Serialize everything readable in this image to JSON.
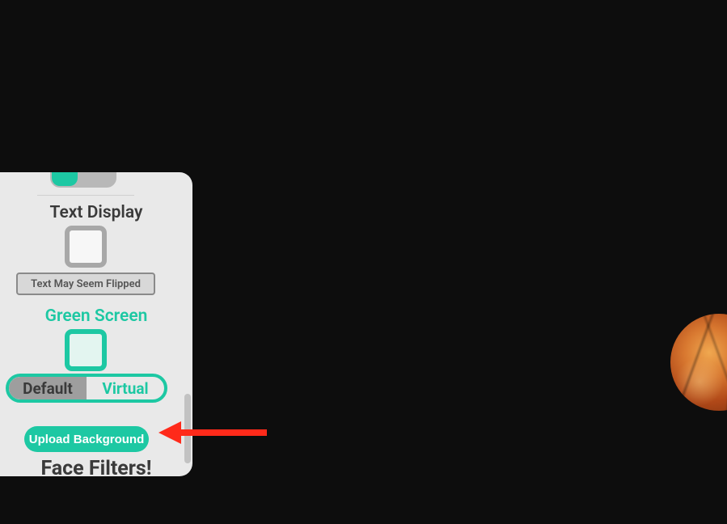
{
  "panel": {
    "text_display_title": "Text Display",
    "flip_note": "Text May Seem Flipped",
    "green_screen_title": "Green Screen",
    "mode": {
      "default_label": "Default",
      "virtual_label": "Virtual"
    },
    "upload_label": "Upload Background",
    "face_filters_title": "Face Filters!"
  }
}
